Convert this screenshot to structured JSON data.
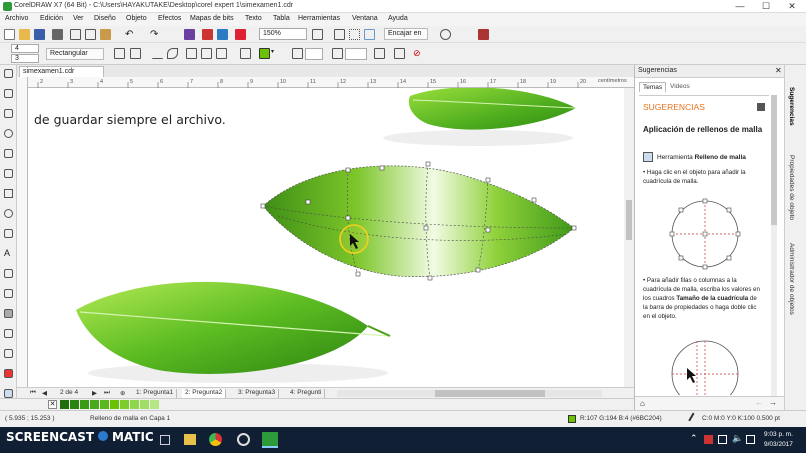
{
  "window": {
    "title": "CorelDRAW X7 (64 Bit) - C:\\Users\\HAYAKUTAKE\\Desktop\\corel expert 1\\simexamen1.cdr",
    "minimize": "—",
    "maximize": "☐",
    "close": "✕"
  },
  "menu": [
    "Archivo",
    "Edición",
    "Ver",
    "Diseño",
    "Objeto",
    "Efectos",
    "Mapas de bits",
    "Texto",
    "Tabla",
    "Herramientas",
    "Ventana",
    "Ayuda"
  ],
  "toolbar1": {
    "zoom": "150%",
    "snap": "Encajar en"
  },
  "toolbar2": {
    "w1": "4",
    "w2": "3",
    "shape": "Rectangular"
  },
  "document": {
    "tab": "simexamen1.cdr",
    "canvas_text": "de guardar siempre el archivo.",
    "ruler_units": "centímetros",
    "ruler_ticks": [
      "2",
      "3",
      "4",
      "5",
      "6",
      "7",
      "8",
      "9",
      "10",
      "11",
      "12",
      "13",
      "14",
      "15",
      "16",
      "17",
      "18",
      "19",
      "20"
    ]
  },
  "pages": {
    "counter": "2 de 4",
    "tabs": [
      "1: Pregunta1",
      "2: Pregunta2",
      "3: Pregunta3",
      "4: Pregunti"
    ],
    "active": 1
  },
  "panel": {
    "title": "Sugerencias",
    "tabs": [
      "Temas",
      "Videos"
    ],
    "section": "SUGERENCIAS",
    "heading": "Aplicación de rellenos de malla",
    "tool_prefix": "Herramienta",
    "tool_name": "Relleno de malla",
    "bullet1": "• Haga clic en el objeto para añadir la cuadrícula de malla.",
    "bullet2_a": "• Para añadir filas o columnas a la cuadrícula de malla, escriba los valores en los cuadros",
    "bullet2_b": "Tamaño de la cuadrícula",
    "bullet2_c": "de la barra de propiedades o haga doble clic en el objeto."
  },
  "side_tabs": [
    "Sugerencias",
    "Propiedades de objeto",
    "Administrador de objetos"
  ],
  "status": {
    "coords": "( 5.935 ; 15.253 )",
    "info": "Relleno de malla en Capa 1",
    "fill": "R:107 G:194 B:4 (#6BC204)",
    "outline": "C:0 M:0 Y:0 K:100  0.500 pt"
  },
  "taskbar": {
    "brand": "SCREENCAST",
    "brand2": "MATIC",
    "time": "9:03 p. m.",
    "date": "9/03/2017"
  },
  "colors": {
    "leaf": "#6BC204",
    "leaf_dark": "#3e8e16",
    "taskbar": "#101f33",
    "accent": "#e8731a"
  }
}
